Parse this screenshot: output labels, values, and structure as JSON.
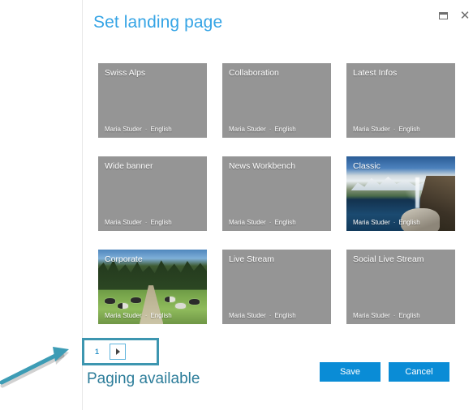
{
  "dialog": {
    "title": "Set landing page",
    "window_controls": [
      {
        "name": "restore",
        "glyph": "restore-icon"
      },
      {
        "name": "close",
        "glyph": "close-icon"
      }
    ]
  },
  "tiles": [
    [
      {
        "title": "Swiss Alps",
        "author": "Maria Studer",
        "separator": "·",
        "language": "English",
        "thumb": "none"
      },
      {
        "title": "Collaboration",
        "author": "Maria Studer",
        "separator": "·",
        "language": "English",
        "thumb": "none"
      },
      {
        "title": "Latest Infos",
        "author": "Maria Studer",
        "separator": "·",
        "language": "English",
        "thumb": "none"
      }
    ],
    [
      {
        "title": "Wide banner",
        "author": "Maria Studer",
        "separator": "·",
        "language": "English",
        "thumb": "none"
      },
      {
        "title": "News Workbench",
        "author": "Maria Studer",
        "separator": "·",
        "language": "English",
        "thumb": "none"
      },
      {
        "title": "Classic",
        "author": "Maria Studer",
        "separator": "·",
        "language": "English",
        "thumb": "mountain-lake-photo"
      }
    ],
    [
      {
        "title": "Corporate",
        "author": "Maria Studer",
        "separator": "·",
        "language": "English",
        "thumb": "pasture-cows-photo"
      },
      {
        "title": "Live Stream",
        "author": "Maria Studer",
        "separator": "·",
        "language": "English",
        "thumb": "none"
      },
      {
        "title": "Social Live Stream",
        "author": "Maria Studer",
        "separator": "·",
        "language": "English",
        "thumb": "none"
      }
    ]
  ],
  "pager": {
    "current_page": "1",
    "next_label": "next-page-icon"
  },
  "actions": {
    "save_label": "Save",
    "cancel_label": "Cancel"
  },
  "annotation": {
    "text": "Paging available"
  },
  "colors": {
    "title_blue": "#35a4e5",
    "button_blue": "#0a8cd6",
    "tile_gray": "#959595",
    "annotation_teal": "#2d7d9a",
    "pager_border_teal": "#3d96b0"
  }
}
